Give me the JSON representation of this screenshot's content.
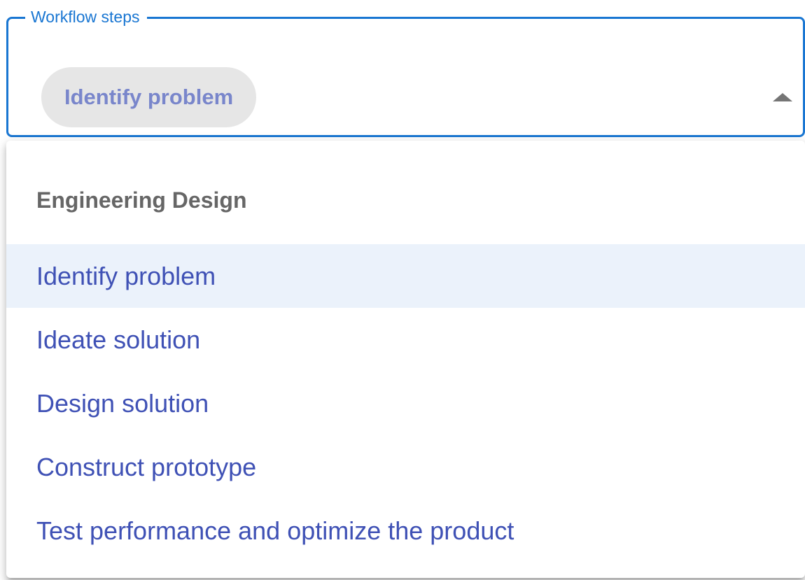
{
  "select": {
    "label": "Workflow steps",
    "selected_chip": "Identify problem",
    "toggle_icon": "arrow-drop-up-icon",
    "expanded": true
  },
  "menu": {
    "group_header": "Engineering Design",
    "options": [
      {
        "label": "Identify problem",
        "selected": true
      },
      {
        "label": "Ideate solution",
        "selected": false
      },
      {
        "label": "Design solution",
        "selected": false
      },
      {
        "label": "Construct prototype",
        "selected": false
      },
      {
        "label": "Test performance and optimize the product",
        "selected": false
      }
    ]
  },
  "colors": {
    "accent": "#1976d2",
    "option_text": "#3f51b5",
    "chip_text": "#7986cb",
    "chip_bg": "#e6e6e6",
    "selected_bg": "#ebf2fb",
    "header_text": "#666666"
  }
}
